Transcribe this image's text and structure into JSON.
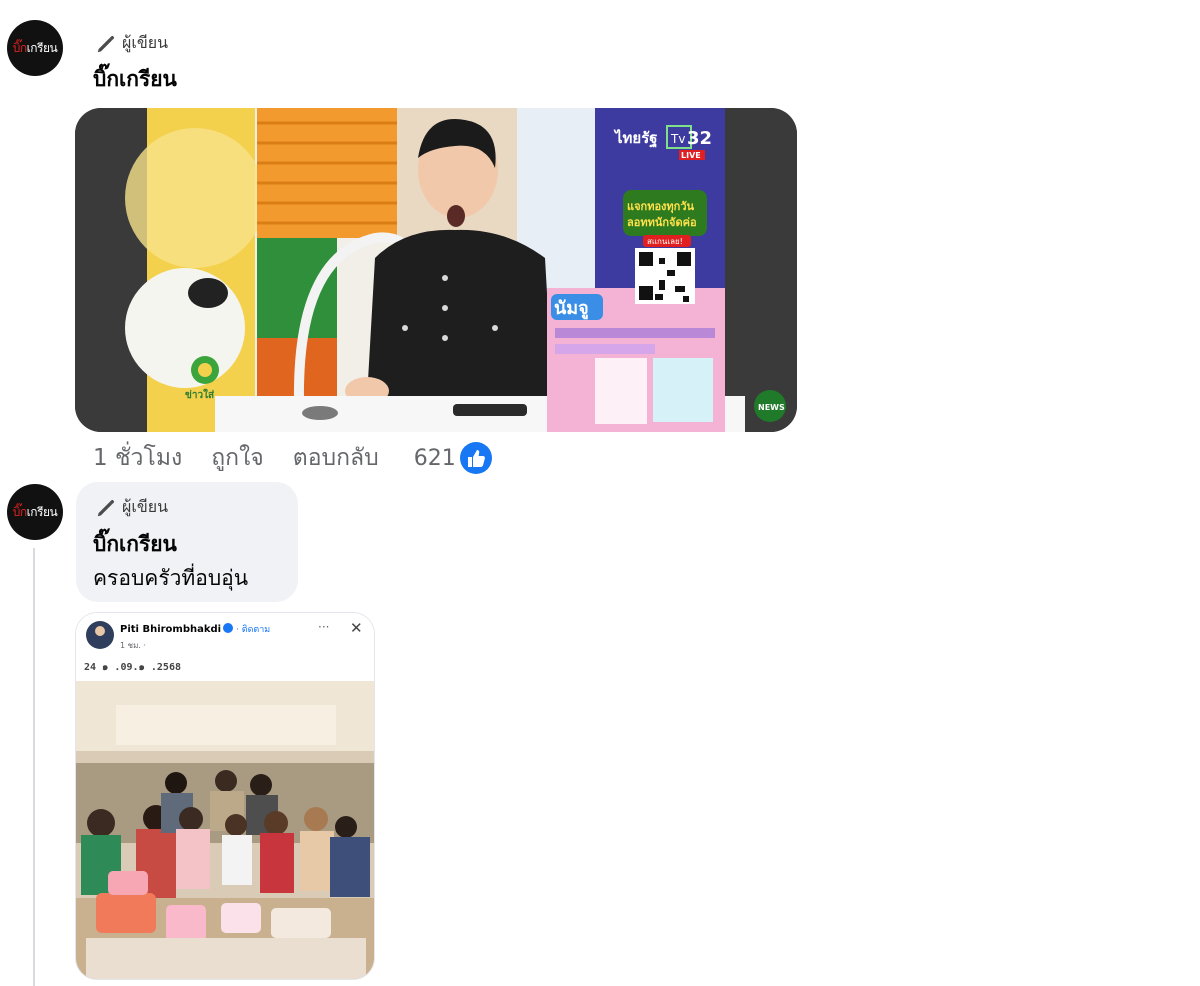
{
  "comment1": {
    "avatar_prefix": "บิ๊ก",
    "avatar_rest": "เกรียน",
    "author_badge": "ผู้เขียน",
    "name": "บิ๊กเกรียน",
    "media": {
      "channel_name": "ไทยรัฐ",
      "channel_number": "32",
      "live_label": "LIVE",
      "promo_line1": "แจกทองทุกวัน",
      "promo_line2": "ลอททนักจัดค่อ",
      "promo_line3": "สแกนเลย!",
      "product_name": "นัมจู",
      "news_badge": "NEWS",
      "left_logo": "ข่าวใส่"
    },
    "actions": {
      "time": "1 ชั่วโมง",
      "like": "ถูกใจ",
      "reply": "ตอบกลับ"
    },
    "reaction_count": "621"
  },
  "comment2": {
    "avatar_prefix": "บิ๊ก",
    "avatar_rest": "เกรียน",
    "author_badge": "ผู้เขียน",
    "name": "บิ๊กเกรียน",
    "text": "ครอบครัวที่อบอุ่น",
    "media": {
      "post_author": "Piti Bhirombhakdi",
      "follow_label": "· ติดตาม",
      "post_meta": "1 ชม. · ",
      "post_text": "24 ๑ .09.๑ .2568",
      "more_icon": "···",
      "close_icon": "✕"
    }
  },
  "colors": {
    "accent_blue": "#1877f2",
    "bubble_bg": "#f0f2f5",
    "secondary_text": "#65676b"
  }
}
